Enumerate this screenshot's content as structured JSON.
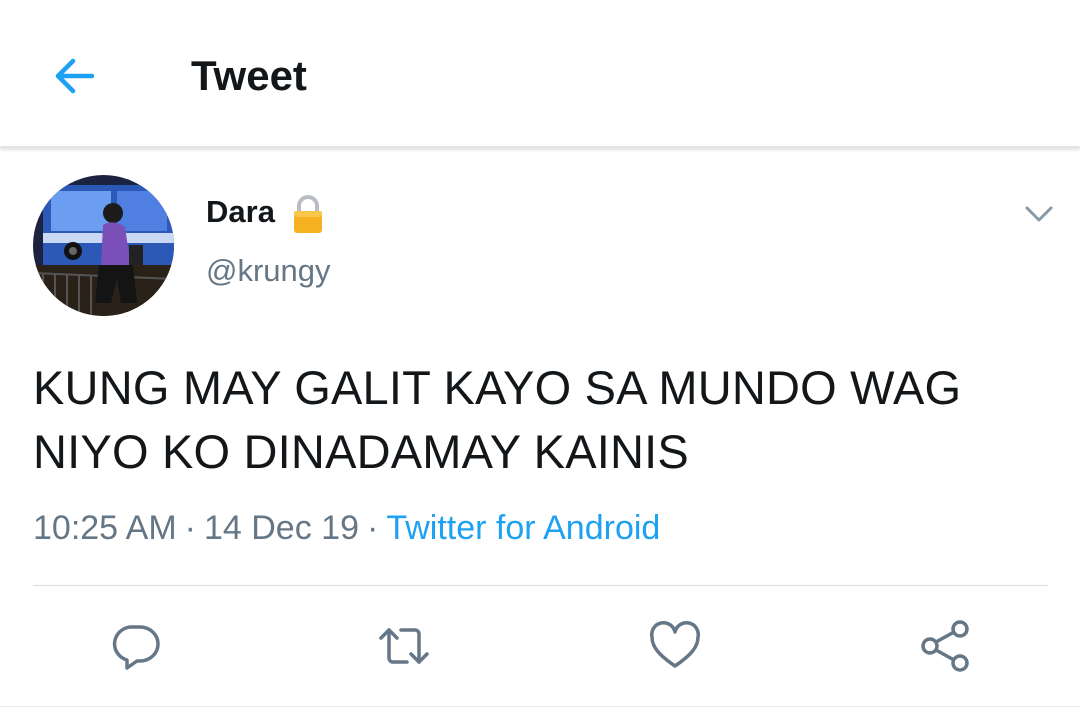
{
  "header": {
    "title": "Tweet",
    "back_icon": "back-arrow-icon",
    "accent_color": "#1da1f2"
  },
  "tweet": {
    "author": {
      "display_name": "Dara",
      "handle": "@krungy",
      "protected_icon": "lock-icon"
    },
    "text_line_1": "KUNG MAY GALIT KAYO SA MUNDO WAG",
    "text_line_2": "NIYO KO DINADAMAY KAINIS",
    "time": "10:25 AM",
    "date": "14 Dec 19",
    "separator": "·",
    "source": "Twitter for Android"
  },
  "actions": {
    "icons": [
      "reply-icon",
      "retweet-icon",
      "like-icon",
      "share-icon"
    ],
    "icon_color": "#657786"
  },
  "colors": {
    "text_primary": "#14171a",
    "text_secondary": "#657786",
    "link": "#1da1f2",
    "lock": "#f5b120"
  }
}
